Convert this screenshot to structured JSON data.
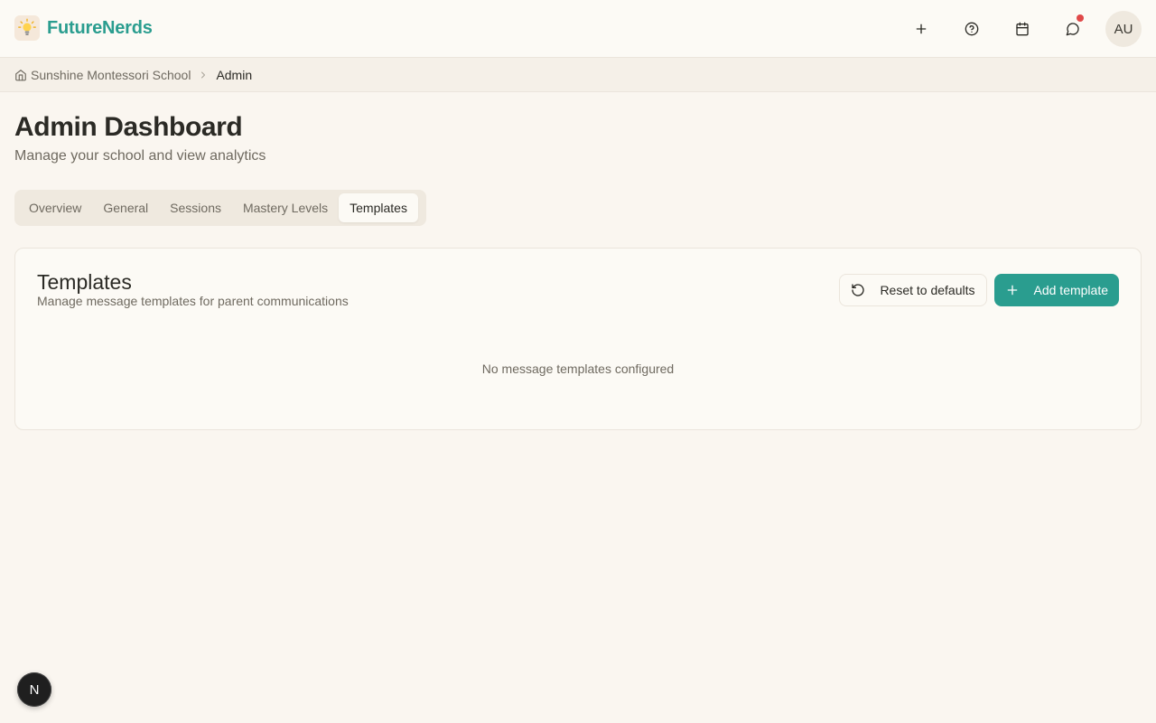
{
  "app": {
    "name": "FutureNerds"
  },
  "header": {
    "actions": [
      "plus-icon",
      "help-circle-icon",
      "calendar-icon",
      "message-circle-icon"
    ],
    "notification_dot_color": "#e04848",
    "avatar_initials": "AU"
  },
  "breadcrumb": {
    "home_label": "Sunshine Montessori School",
    "current_label": "Admin"
  },
  "page": {
    "title": "Admin Dashboard",
    "subtitle": "Manage your school and view analytics"
  },
  "tabs": [
    {
      "label": "Overview",
      "active": false
    },
    {
      "label": "General",
      "active": false
    },
    {
      "label": "Sessions",
      "active": false
    },
    {
      "label": "Mastery Levels",
      "active": false
    },
    {
      "label": "Templates",
      "active": true
    }
  ],
  "templates_card": {
    "title": "Templates",
    "description": "Manage message templates for parent communications",
    "reset_label": "Reset to defaults",
    "add_label": "Add template",
    "empty_message": "No message templates configured"
  },
  "dev_badge": {
    "letter": "N"
  },
  "colors": {
    "brand": "#2a9d8f",
    "background": "#faf6f0",
    "text": "#2b2a25",
    "muted_text": "#6f6a60"
  }
}
